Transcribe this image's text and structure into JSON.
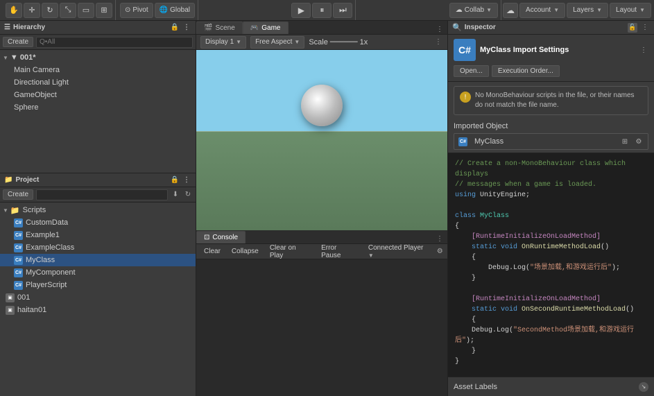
{
  "toolbar": {
    "pivot_label": "Pivot",
    "global_label": "Global",
    "collab_label": "Collab",
    "account_label": "Account",
    "layers_label": "Layers",
    "layout_label": "Layout"
  },
  "hierarchy": {
    "title": "Hierarchy",
    "create_label": "Create",
    "search_placeholder": "Q•All",
    "root_item": "▼ 001*",
    "items": [
      {
        "label": "Main Camera"
      },
      {
        "label": "Directional Light"
      },
      {
        "label": "GameObject"
      },
      {
        "label": "Sphere"
      }
    ]
  },
  "project": {
    "title": "Project",
    "create_label": "Create",
    "items": [
      {
        "label": "Scripts",
        "type": "folder"
      },
      {
        "label": "CustomData",
        "type": "cs"
      },
      {
        "label": "Example1",
        "type": "cs"
      },
      {
        "label": "ExampleClass",
        "type": "cs"
      },
      {
        "label": "MyClass",
        "type": "cs",
        "selected": true
      },
      {
        "label": "MyComponent",
        "type": "cs"
      },
      {
        "label": "PlayerScript",
        "type": "cs"
      },
      {
        "label": "001",
        "type": "scene"
      },
      {
        "label": "haitan01",
        "type": "scene"
      }
    ]
  },
  "scene_tab": {
    "label": "Scene"
  },
  "game_tab": {
    "label": "Game"
  },
  "game_view": {
    "display_label": "Display 1",
    "aspect_label": "Free Aspect",
    "scale_label": "Scale",
    "scale_value": "1x"
  },
  "console": {
    "title": "Console",
    "clear_label": "Clear",
    "collapse_label": "Collapse",
    "clear_on_play_label": "Clear on Play",
    "error_pause_label": "Error Pause",
    "connected_player_label": "Connected Player"
  },
  "inspector": {
    "title": "Inspector",
    "import_settings_title": "MyClass Import Settings",
    "open_label": "Open...",
    "execution_order_label": "Execution Order...",
    "warning_text": "No MonoBehaviour scripts in the file, or their names do not match the file name.",
    "imported_object_label": "Imported Object",
    "myclass_label": "MyClass",
    "asset_labels_label": "Asset Labels",
    "code": [
      {
        "type": "comment",
        "text": "// Create a non-MonoBehaviour class which displays"
      },
      {
        "type": "comment",
        "text": "// messages when a game is loaded."
      },
      {
        "type": "keyword",
        "text": "using UnityEngine;"
      },
      {
        "type": "blank"
      },
      {
        "type": "keyword",
        "text": "class "
      },
      {
        "type": "class",
        "text": "MyClass"
      },
      {
        "type": "brace",
        "text": "{"
      },
      {
        "type": "attr",
        "text": "    [RuntimeInitializeOnLoadMethod]"
      },
      {
        "type": "normal",
        "text": "    static void "
      },
      {
        "type": "method",
        "text": "OnRuntimeMethodLoad"
      },
      {
        "type": "normal",
        "text": "()"
      },
      {
        "type": "brace",
        "text": "    {"
      },
      {
        "type": "normal",
        "text": "        Debug.Log("
      },
      {
        "type": "string",
        "text": "\"场景加载,和游戏运行后\""
      },
      {
        "type": "normal",
        "text": ");"
      },
      {
        "type": "brace",
        "text": "    }"
      },
      {
        "type": "blank"
      },
      {
        "type": "attr",
        "text": "    [RuntimeInitializeOnLoadMethod]"
      },
      {
        "type": "normal",
        "text": "    static void "
      },
      {
        "type": "method",
        "text": "OnSecondRuntimeMethodLoad"
      },
      {
        "type": "normal",
        "text": "()"
      },
      {
        "type": "brace",
        "text": "    {"
      },
      {
        "type": "normal",
        "text": "        Debug.Log("
      },
      {
        "type": "string",
        "text": "\"SecondMethod场景加载,和游戏运行后\""
      },
      {
        "type": "normal",
        "text": ");"
      },
      {
        "type": "brace",
        "text": "    }"
      },
      {
        "type": "brace",
        "text": "}"
      }
    ]
  }
}
